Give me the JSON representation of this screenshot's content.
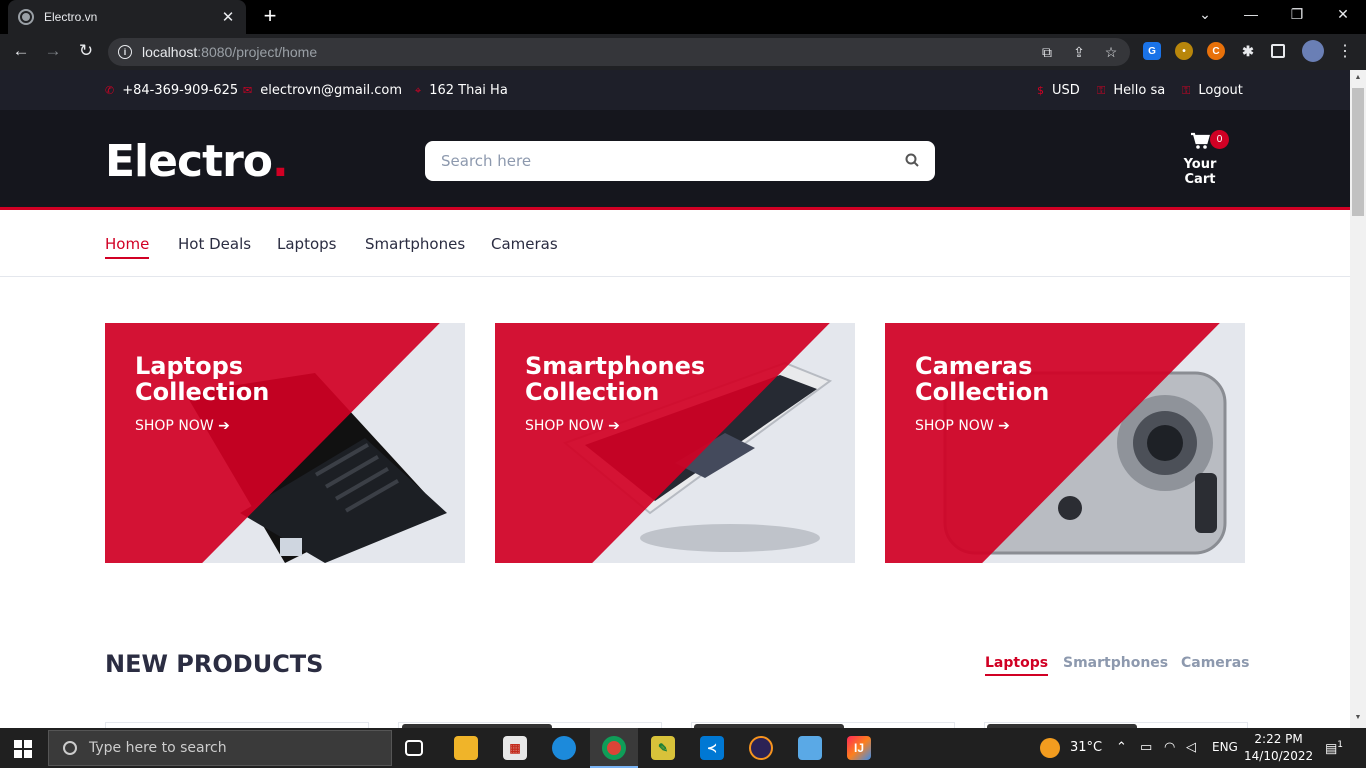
{
  "browser": {
    "tab_title": "Electro.vn",
    "tab_close": "✕",
    "new_tab": "+",
    "url_host": "localhost",
    "url_rest": ":8080/project/home",
    "window_controls": [
      "⌄",
      "—",
      "❐",
      "✕"
    ]
  },
  "topbar": {
    "phone": "+84-369-909-625",
    "email": "electrovn@gmail.com",
    "address": "162 Thai Ha",
    "currency": "USD",
    "greeting": "Hello sa",
    "logout": "Logout"
  },
  "header": {
    "logo": "Electro",
    "logo_dot": ".",
    "search_placeholder": "Search here",
    "cart_count": "0",
    "cart_label": "Your Cart"
  },
  "nav": {
    "items": [
      "Home",
      "Hot Deals",
      "Laptops",
      "Smartphones",
      "Cameras"
    ],
    "active": "Home"
  },
  "collections": [
    {
      "line1": "Laptops",
      "line2": "Collection",
      "cta": "SHOP NOW ➔"
    },
    {
      "line1": "Smartphones",
      "line2": "Collection",
      "cta": "SHOP NOW ➔"
    },
    {
      "line1": "Cameras",
      "line2": "Collection",
      "cta": "SHOP NOW ➔"
    }
  ],
  "new_products": {
    "title": "NEW PRODUCTS",
    "tabs": [
      "Laptops",
      "Smartphones",
      "Cameras"
    ],
    "active_tab": "Laptops"
  },
  "taskbar": {
    "search_placeholder": "Type here to search",
    "temperature": "31°C",
    "language": "ENG",
    "time": "2:22 PM",
    "date": "14/10/2022",
    "notifications": "1"
  },
  "colors": {
    "brand_red": "#d10024",
    "dark": "#15161d",
    "topbar": "#1e1f29"
  }
}
